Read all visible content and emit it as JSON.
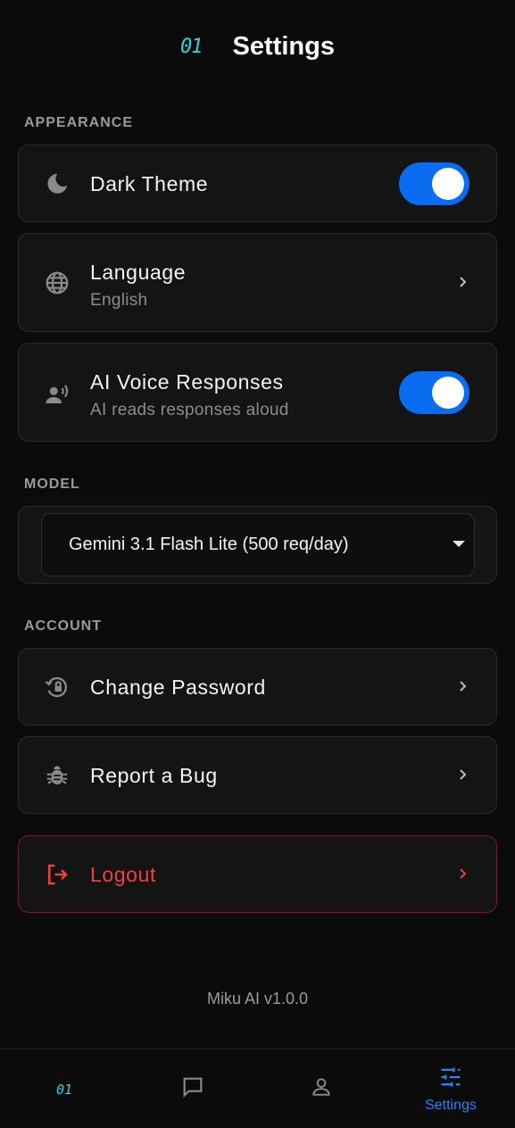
{
  "header": {
    "logo": "01",
    "title": "Settings"
  },
  "sections": {
    "appearance": "APPEARANCE",
    "model": "MODEL",
    "account": "ACCOUNT"
  },
  "appearance": {
    "dark_theme": {
      "label": "Dark Theme",
      "enabled": true,
      "icon": "moon-icon"
    },
    "language": {
      "label": "Language",
      "value": "English",
      "icon": "globe-icon"
    },
    "ai_voice": {
      "label": "AI Voice Responses",
      "description": "AI reads responses aloud",
      "enabled": true,
      "icon": "voice-icon"
    }
  },
  "model": {
    "selected": "Gemini 3.1 Flash Lite (500 req/day)"
  },
  "account": {
    "change_password": {
      "label": "Change Password",
      "icon": "lock-reset-icon"
    },
    "report_bug": {
      "label": "Report a Bug",
      "icon": "bug-icon"
    },
    "logout": {
      "label": "Logout",
      "icon": "logout-icon"
    }
  },
  "version": "Miku AI v1.0.0",
  "nav": {
    "home_logo": "01",
    "settings_label": "Settings",
    "active": "settings"
  },
  "colors": {
    "accent": "#0a6cf0",
    "logo": "#2fd6e0",
    "danger": "#e8443d",
    "background": "#0b0b0b",
    "card": "#141414"
  }
}
